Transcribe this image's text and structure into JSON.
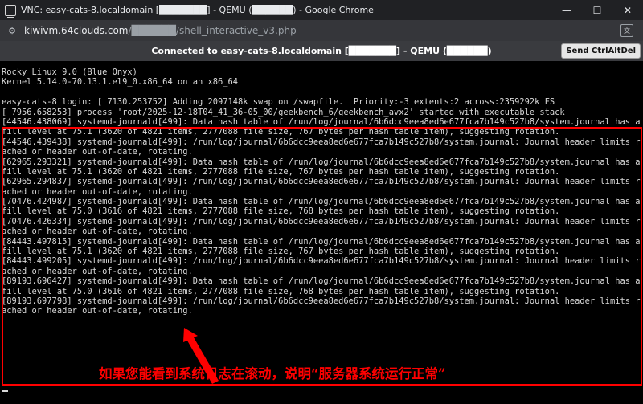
{
  "window": {
    "title": "VNC: easy-cats-8.localdomain [███████] - QEMU (██████) - Google Chrome",
    "minimize": "—",
    "maximize": "☐",
    "close": "✕"
  },
  "address": {
    "host": "kiwivm.64clouds.com",
    "path": "/██████/shell_interactive_v3.php"
  },
  "vnc": {
    "status": "Connected to easy-cats-8.localdomain [███████] - QEMU (██████)",
    "ctrl_alt_del": "Send CtrlAltDel"
  },
  "console": {
    "lines": [
      "Rocky Linux 9.0 (Blue Onyx)",
      "Kernel 5.14.0-70.13.1.el9_0.x86_64 on an x86_64",
      "",
      "easy-cats-8 login: [ 7130.253752] Adding 2097148k swap on /swapfile.  Priority:-3 extents:2 across:2359292k FS",
      "[ 7956.658253] process 'root/2025-12-18T04_41_36-05_00/geekbench_6/geekbench_avx2' started with executable stack",
      "[44546.438069] systemd-journald[499]: Data hash table of /run/log/journal/6b6dcc9eea8ed6e677fca7b149c527b8/system.journal has a",
      "fill level at 75.1 (3620 of 4821 items, 2777088 file size, 767 bytes per hash table item), suggesting rotation.",
      "[44546.439438] systemd-journald[499]: /run/log/journal/6b6dcc9eea8ed6e677fca7b149c527b8/system.journal: Journal header limits re",
      "ached or header out-of-date, rotating.",
      "[62965.293321] systemd-journald[499]: Data hash table of /run/log/journal/6b6dcc9eea8ed6e677fca7b149c527b8/system.journal has a",
      "fill level at 75.1 (3620 of 4821 items, 2777088 file size, 767 bytes per hash table item), suggesting rotation.",
      "[62965.294837] systemd-journald[499]: /run/log/journal/6b6dcc9eea8ed6e677fca7b149c527b8/system.journal: Journal header limits re",
      "ached or header out-of-date, rotating.",
      "[70476.424987] systemd-journald[499]: Data hash table of /run/log/journal/6b6dcc9eea8ed6e677fca7b149c527b8/system.journal has a",
      "fill level at 75.0 (3616 of 4821 items, 2777088 file size, 768 bytes per hash table item), suggesting rotation.",
      "[70476.426334] systemd-journald[499]: /run/log/journal/6b6dcc9eea8ed6e677fca7b149c527b8/system.journal: Journal header limits re",
      "ached or header out-of-date, rotating.",
      "[84443.497815] systemd-journald[499]: Data hash table of /run/log/journal/6b6dcc9eea8ed6e677fca7b149c527b8/system.journal has a",
      "fill level at 75.1 (3620 of 4821 items, 2777088 file size, 767 bytes per hash table item), suggesting rotation.",
      "[84443.499205] systemd-journald[499]: /run/log/journal/6b6dcc9eea8ed6e677fca7b149c527b8/system.journal: Journal header limits re",
      "ached or header out-of-date, rotating.",
      "[89193.696427] systemd-journald[499]: Data hash table of /run/log/journal/6b6dcc9eea8ed6e677fca7b149c527b8/system.journal has a",
      "fill level at 75.0 (3616 of 4821 items, 2777088 file size, 768 bytes per hash table item), suggesting rotation.",
      "[89193.697798] systemd-journald[499]: /run/log/journal/6b6dcc9eea8ed6e677fca7b149c527b8/system.journal: Journal header limits re",
      "ached or header out-of-date, rotating."
    ]
  },
  "annotation": {
    "caption": "如果您能看到系统日志在滚动，说明“服务器系统运行正常”",
    "color": "#ff0000"
  },
  "colors": {
    "titlebar": "#202124",
    "addressbar": "#35363a",
    "vnc_toolbar": "#3a3b3f",
    "console_bg": "#000000",
    "console_text": "#d9d9d9",
    "highlight": "#ff0000"
  },
  "icons": {
    "app": "vnc-window-icon",
    "site": "site-settings-icon",
    "translate": "translate-icon"
  }
}
